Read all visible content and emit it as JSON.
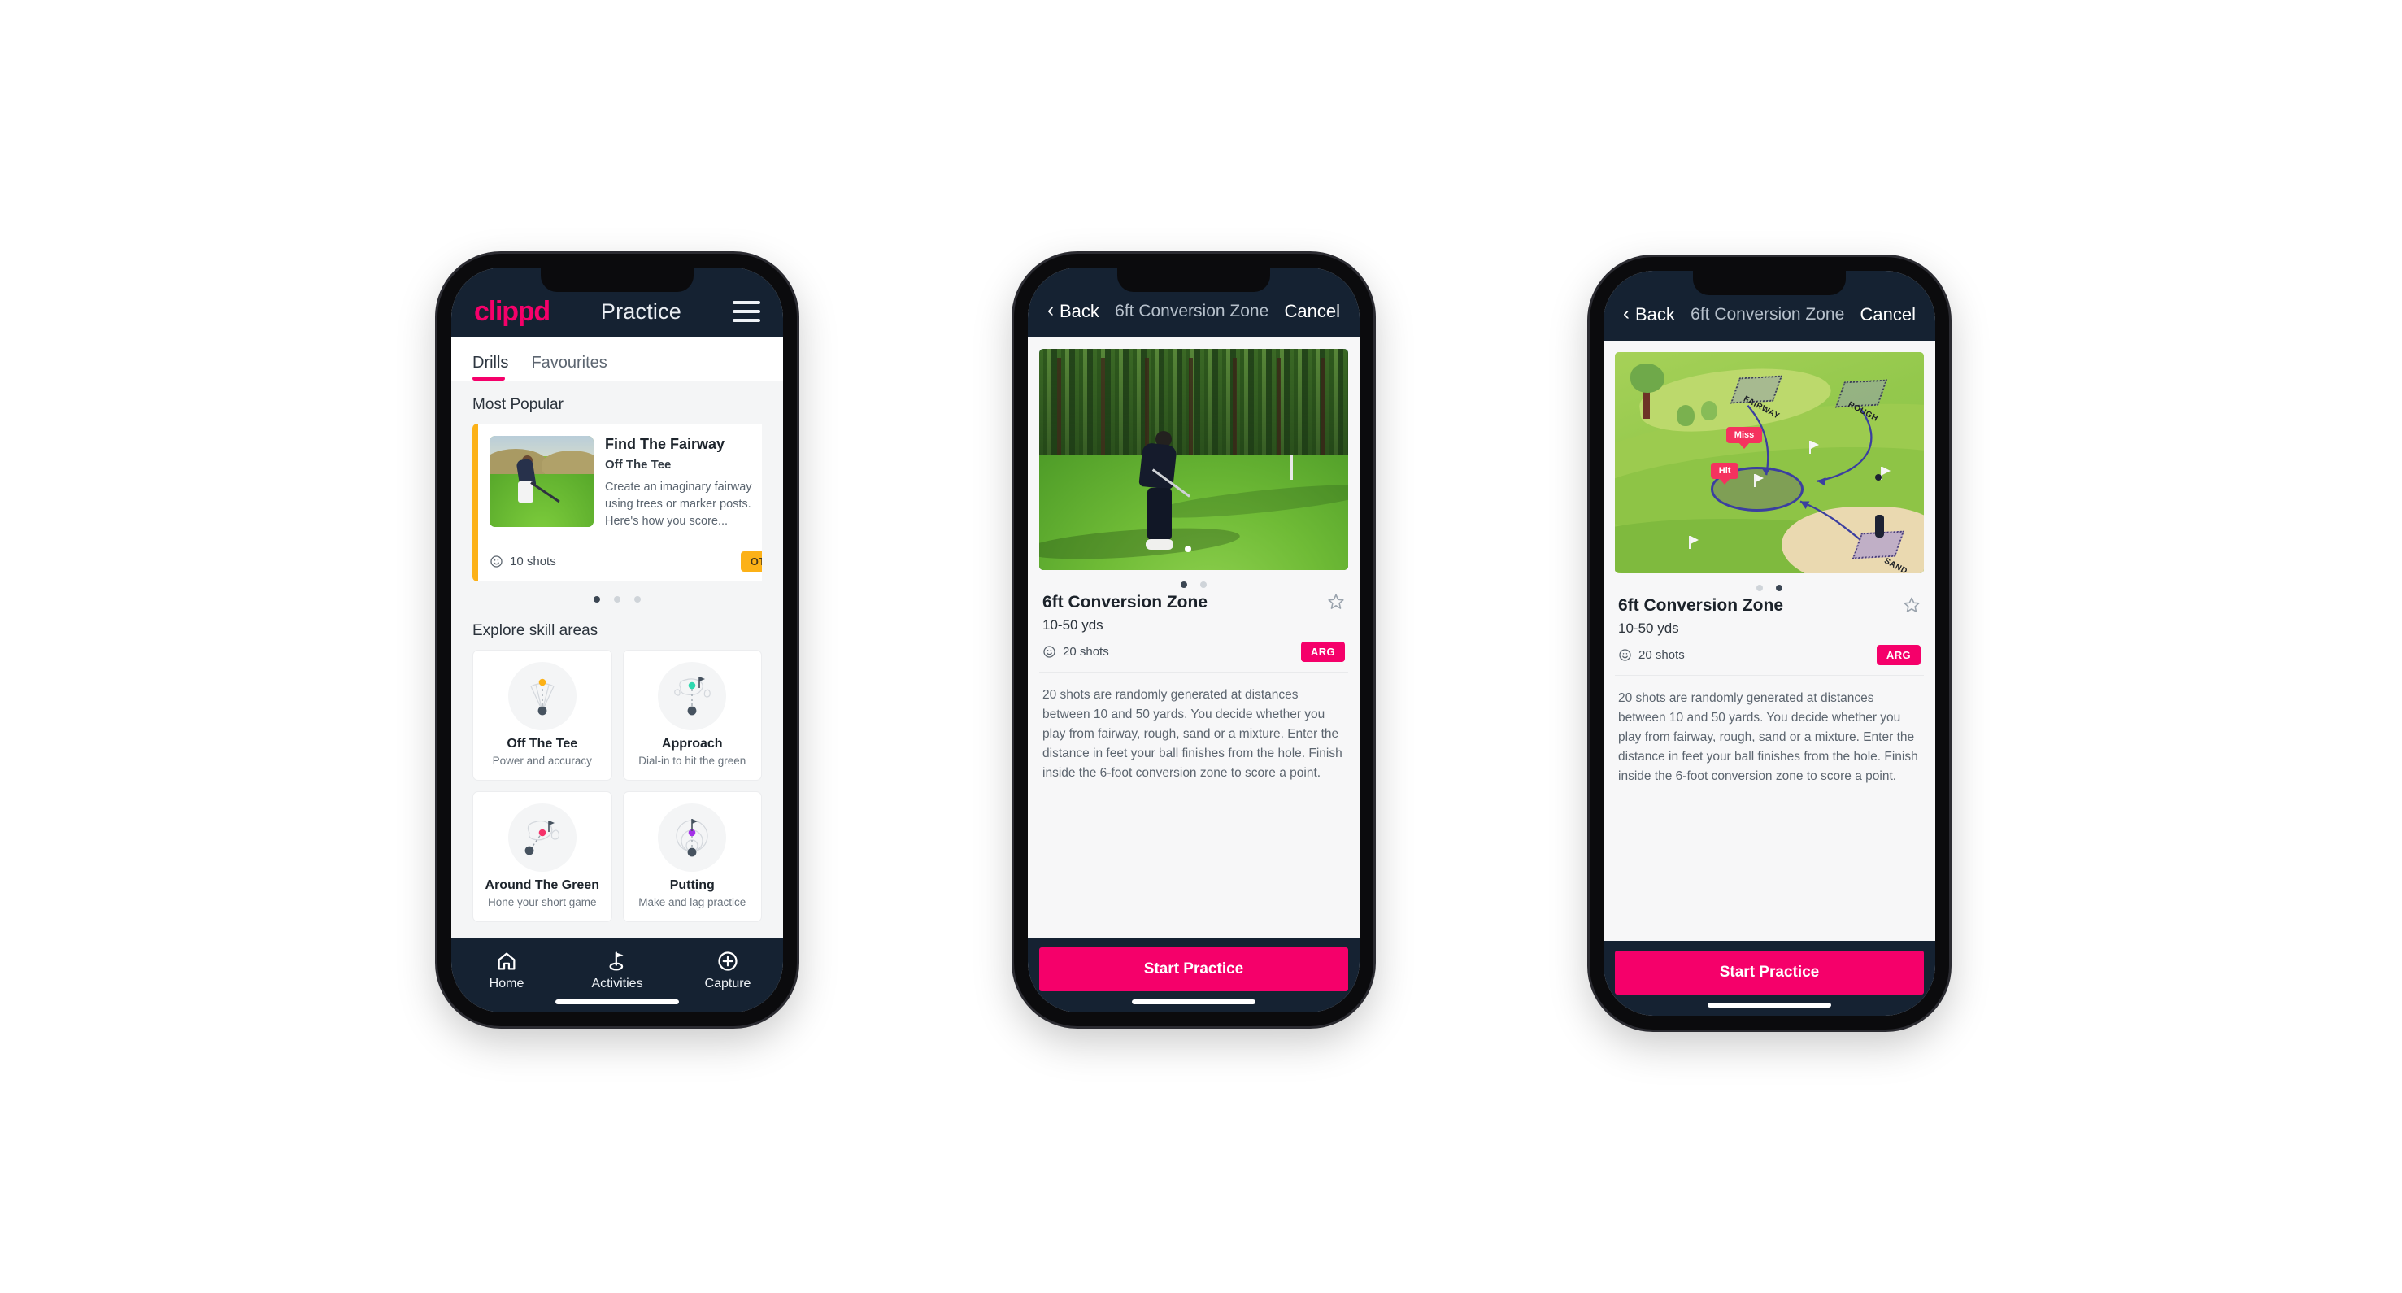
{
  "brand": {
    "name": "clippd",
    "accent": "#f5006a",
    "header_bg": "#152232",
    "ott_color": "#fcb117",
    "arg_color": "#f5006a",
    "teal_color": "#3fe0bd"
  },
  "phone1": {
    "appbar": {
      "logo": "clippd",
      "title": "Practice",
      "menu_icon": "hamburger-icon"
    },
    "tabs": [
      {
        "label": "Drills",
        "active": true
      },
      {
        "label": "Favourites",
        "active": false
      }
    ],
    "sections": {
      "most_popular_label": "Most Popular",
      "explore_label": "Explore skill areas"
    },
    "featured_drill": {
      "title": "Find The Fairway",
      "subtitle": "Off The Tee",
      "description": "Create an imaginary fairway using trees or marker posts. Here's how you score...",
      "shots": "10 shots",
      "badge": "OTT",
      "favourite_icon": "star-outline-icon",
      "shots_icon": "clock-icon",
      "accent_stripe": "#fcb117"
    },
    "carousel_dots": {
      "count": 3,
      "active_index": 0
    },
    "skill_areas": [
      {
        "name": "Off The Tee",
        "desc": "Power and accuracy",
        "icon": "tee-fan-icon",
        "dot_color": "#fcb117"
      },
      {
        "name": "Approach",
        "desc": "Dial-in to hit the green",
        "icon": "approach-green-icon",
        "dot_color": "#2fd9b0"
      },
      {
        "name": "Around The Green",
        "desc": "Hone your short game",
        "icon": "chip-green-icon",
        "dot_color": "#f5326a"
      },
      {
        "name": "Putting",
        "desc": "Make and lag practice",
        "icon": "putting-rings-icon",
        "dot_color": "#a431e8"
      }
    ],
    "bottom_nav": [
      {
        "label": "Home",
        "icon": "home-icon",
        "active": false
      },
      {
        "label": "Activities",
        "icon": "golf-flag-icon",
        "active": true
      },
      {
        "label": "Capture",
        "icon": "plus-circle-icon",
        "active": false
      }
    ]
  },
  "phone2": {
    "navbar": {
      "back": "Back",
      "back_icon": "chevron-left-icon",
      "title": "6ft Conversion Zone",
      "cancel": "Cancel"
    },
    "media": {
      "type": "photo",
      "alt": "Golfer chipping on parkland course"
    },
    "carousel_dots": {
      "count": 2,
      "active_index": 0
    },
    "drill": {
      "name": "6ft Conversion Zone",
      "yards": "10-50 yds",
      "shots": "20 shots",
      "badge": "ARG",
      "favourite_icon": "star-outline-icon",
      "shots_icon": "clock-icon",
      "description": "20 shots are randomly generated at distances between 10 and 50 yards. You decide whether you play from fairway, rough, sand or a mixture. Enter the distance in feet your ball finishes from the hole. Finish inside the 6-foot conversion zone to score a point."
    },
    "cta": "Start Practice"
  },
  "phone3": {
    "navbar": {
      "back": "Back",
      "back_icon": "chevron-left-icon",
      "title": "6ft Conversion Zone",
      "cancel": "Cancel"
    },
    "media": {
      "type": "illustration",
      "alt": "Isometric golf hole diagram",
      "zone_labels": [
        "FAIRWAY",
        "ROUGH",
        "SAND"
      ],
      "markers": [
        "Miss",
        "Hit"
      ]
    },
    "carousel_dots": {
      "count": 2,
      "active_index": 1
    },
    "drill": {
      "name": "6ft Conversion Zone",
      "yards": "10-50 yds",
      "shots": "20 shots",
      "badge": "ARG",
      "favourite_icon": "star-outline-icon",
      "shots_icon": "clock-icon",
      "description": "20 shots are randomly generated at distances between 10 and 50 yards. You decide whether you play from fairway, rough, sand or a mixture. Enter the distance in feet your ball finishes from the hole. Finish inside the 6-foot conversion zone to score a point."
    },
    "cta": "Start Practice"
  }
}
